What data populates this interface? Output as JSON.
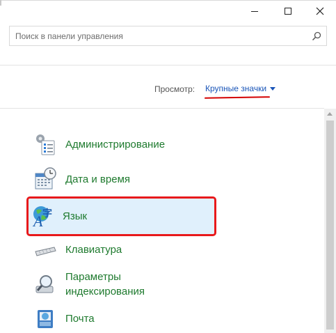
{
  "window": {
    "buttons": {
      "minimize": "",
      "maximize": "",
      "close": ""
    }
  },
  "search": {
    "placeholder": "Поиск в панели управления"
  },
  "view": {
    "label": "Просмотр:",
    "value": "Крупные значки"
  },
  "items": [
    {
      "label": "Администрирование",
      "icon": "admin-tools-icon"
    },
    {
      "label": "Дата и время",
      "icon": "calendar-clock-icon"
    },
    {
      "label": "Язык",
      "icon": "language-globe-icon"
    },
    {
      "label": "Клавиатура",
      "icon": "keyboard-icon"
    },
    {
      "label": "Параметры индексирования",
      "icon": "indexing-magnifier-icon"
    },
    {
      "label": "Почта",
      "icon": "mail-icon"
    }
  ],
  "colors": {
    "link_green": "#1e7a2e",
    "view_blue": "#1a55b8",
    "highlight_red": "#e8191b",
    "highlight_bg": "#e0f0fc"
  }
}
